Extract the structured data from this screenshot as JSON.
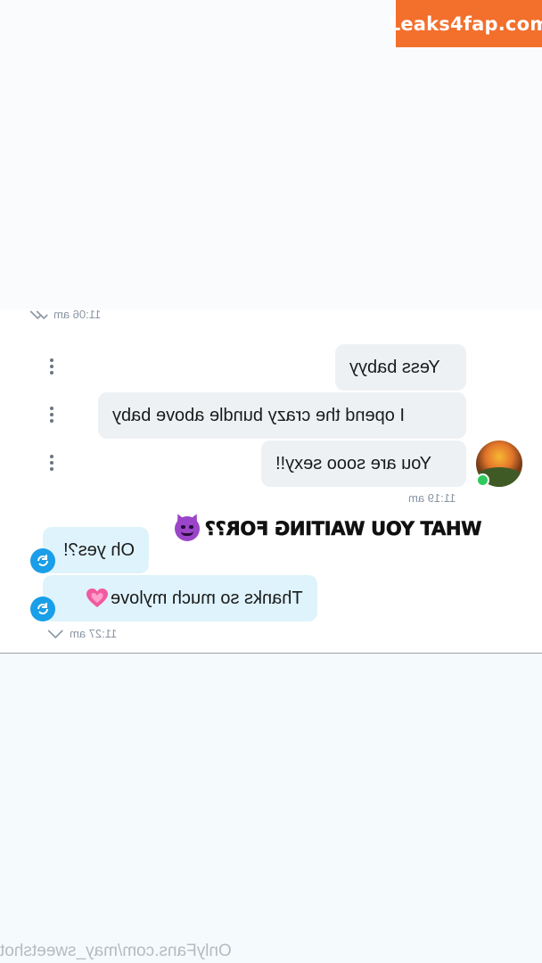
{
  "watermark": {
    "text": "Leaks4fap.com"
  },
  "messages": {
    "first_timestamp": "11:06 am",
    "outgoing": [
      {
        "text": "Yess babyy"
      },
      {
        "text": "I opend the crazy bundle above baby"
      },
      {
        "text": "You are sooo sexy!!"
      }
    ],
    "outgoing_timestamp": "11:19 am",
    "caption": "WHAT YOU WAITING FOR??",
    "incoming": [
      {
        "text": "Oh yes?!"
      },
      {
        "text": "Thanks so much mylove"
      }
    ],
    "incoming_timestamp": "11:27 am"
  },
  "footer": {
    "site": "OnlyFans.com/may_sweetshot"
  },
  "colors": {
    "watermark_bg": "#f36f2c",
    "outgoing_bubble": "#eef1f4",
    "incoming_bubble": "#def3fc",
    "accent_blue": "#1a9ee8",
    "online": "#2fca5d"
  },
  "icons": [
    "double-check-icon",
    "more-vertical-icon",
    "avatar",
    "online-indicator",
    "devil-emoji-icon",
    "repost-icon",
    "pink-heart-icon",
    "single-check-icon"
  ]
}
